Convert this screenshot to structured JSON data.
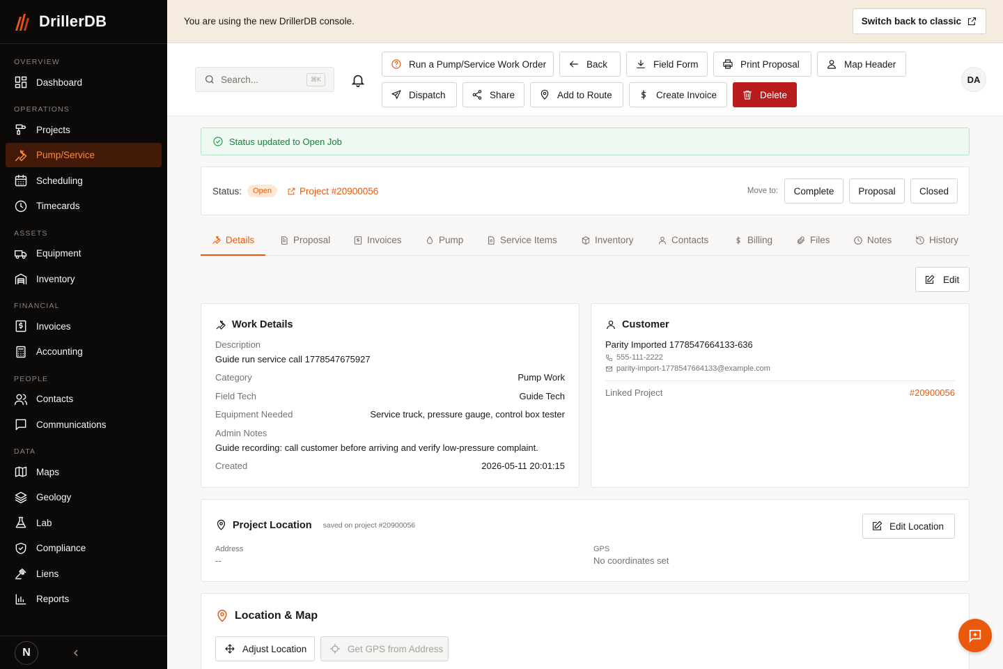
{
  "brand": {
    "name": "DrillerDB",
    "initial": "N"
  },
  "sidebar": {
    "sections": [
      {
        "title": "OVERVIEW",
        "items": [
          {
            "label": "Dashboard",
            "icon": "dashboard-icon"
          }
        ]
      },
      {
        "title": "OPERATIONS",
        "items": [
          {
            "label": "Projects",
            "icon": "drill-icon"
          },
          {
            "label": "Pump/Service",
            "icon": "wrench-icon",
            "active": true
          },
          {
            "label": "Scheduling",
            "icon": "calendar-icon"
          },
          {
            "label": "Timecards",
            "icon": "clock-icon"
          }
        ]
      },
      {
        "title": "ASSETS",
        "items": [
          {
            "label": "Equipment",
            "icon": "truck-icon"
          },
          {
            "label": "Inventory",
            "icon": "warehouse-icon"
          }
        ]
      },
      {
        "title": "FINANCIAL",
        "items": [
          {
            "label": "Invoices",
            "icon": "invoice-icon"
          },
          {
            "label": "Accounting",
            "icon": "calculator-icon"
          }
        ]
      },
      {
        "title": "PEOPLE",
        "items": [
          {
            "label": "Contacts",
            "icon": "users-icon"
          },
          {
            "label": "Communications",
            "icon": "message-icon"
          }
        ]
      },
      {
        "title": "DATA",
        "items": [
          {
            "label": "Maps",
            "icon": "map-icon"
          },
          {
            "label": "Geology",
            "icon": "layers-icon"
          },
          {
            "label": "Lab",
            "icon": "flask-icon"
          },
          {
            "label": "Compliance",
            "icon": "shield-icon"
          },
          {
            "label": "Liens",
            "icon": "gavel-icon"
          },
          {
            "label": "Reports",
            "icon": "bar-chart-icon"
          }
        ]
      }
    ]
  },
  "banner": {
    "text": "You are using the new DrillerDB console.",
    "switch_label": "Switch back to classic"
  },
  "header": {
    "search_placeholder": "Search...",
    "search_shortcut": "⌘K",
    "avatar": "DA",
    "actions": {
      "run_work_order": "Run a Pump/Service Work Order",
      "back": "Back",
      "field_form": "Field Form",
      "print_proposal": "Print Proposal",
      "map_header": "Map Header",
      "dispatch": "Dispatch",
      "share": "Share",
      "add_to_route": "Add to Route",
      "create_invoice": "Create Invoice",
      "delete": "Delete"
    }
  },
  "alert": {
    "text": "Status updated to Open Job"
  },
  "status": {
    "label": "Status:",
    "value": "Open",
    "project_link": "Project #20900056",
    "move_to_label": "Move to:",
    "move_options": [
      "Complete",
      "Proposal",
      "Closed"
    ]
  },
  "tabs": [
    "Details",
    "Proposal",
    "Invoices",
    "Pump",
    "Service Items",
    "Inventory",
    "Contacts",
    "Billing",
    "Files",
    "Notes",
    "History"
  ],
  "edit_label": "Edit",
  "work_details": {
    "title": "Work Details",
    "description_label": "Description",
    "description": "Guide run service call 1778547675927",
    "category_label": "Category",
    "category": "Pump Work",
    "field_tech_label": "Field Tech",
    "field_tech": "Guide Tech",
    "equipment_label": "Equipment Needed",
    "equipment": "Service truck, pressure gauge, control box tester",
    "admin_notes_label": "Admin Notes",
    "admin_notes": "Guide recording: call customer before arriving and verify low-pressure complaint.",
    "created_label": "Created",
    "created": "2026-05-11 20:01:15"
  },
  "customer": {
    "title": "Customer",
    "name": "Parity Imported 1778547664133-636",
    "phone": "555-111-2222",
    "email": "parity-import-1778547664133@example.com",
    "linked_project_label": "Linked Project",
    "linked_project": "#20900056"
  },
  "project_location": {
    "title": "Project Location",
    "subtitle": "saved on project #20900056",
    "edit_label": "Edit Location",
    "address_label": "Address",
    "address": "--",
    "gps_label": "GPS",
    "gps": "No coordinates set"
  },
  "location_map": {
    "title": "Location & Map",
    "adjust_label": "Adjust Location",
    "gps_label": "Get GPS from Address"
  },
  "colors": {
    "accent": "#ea580c",
    "sidebar_bg": "#0c0a09",
    "active_nav_bg": "#431a08",
    "danger": "#b91c1c",
    "banner_bg": "#f6ebdf",
    "success": "#15803d"
  }
}
